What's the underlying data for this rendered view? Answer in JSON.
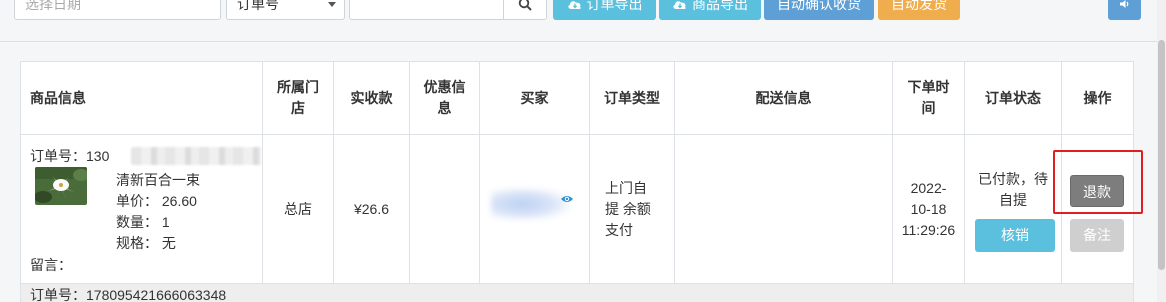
{
  "toolbar": {
    "date_placeholder": "选择日期",
    "search_type": "订单号",
    "search_value": "",
    "export_orders_label": "订单导出",
    "export_goods_label": "商品导出",
    "auto_confirm_label": "自动确认收货",
    "auto_ship_label": "自动发货"
  },
  "table": {
    "headers": {
      "goods": "商品信息",
      "store": "所属门店",
      "paid": "实收款",
      "discount": "优惠信息",
      "buyer": "买家",
      "order_type": "订单类型",
      "delivery": "配送信息",
      "order_time": "下单时间",
      "status": "订单状态",
      "actions": "操作"
    },
    "order": {
      "order_no_label": "订单号：",
      "order_no_prefix": "130",
      "product_name": "清新百合一束",
      "unit_price": "单价：  26.60",
      "quantity": "数量：  1",
      "spec": "规格：  无",
      "remark": "留言：",
      "store": "总店",
      "paid": "¥26.6",
      "discount": "",
      "order_type": "上门自提 余额支付",
      "delivery": "",
      "order_time": "2022- 10-18 11:29:26",
      "status": "已付款，待自提",
      "verify_label": "核销",
      "refund_label": "退款",
      "note_label": "备注"
    },
    "next_order": {
      "order_no_text": "订单号：178095421666063348"
    }
  },
  "colors": {
    "info_button": "#5bc0de",
    "primary_button": "#5e9fd6",
    "warning_button": "#f0ad4e",
    "refund_button": "#7d7d7d",
    "disabled_button": "#cfcfcf",
    "highlight": "#e02020"
  },
  "icons": [
    "search-icon",
    "cloud-download-icon",
    "sound-icon",
    "eye-icon",
    "caret-down-icon"
  ]
}
